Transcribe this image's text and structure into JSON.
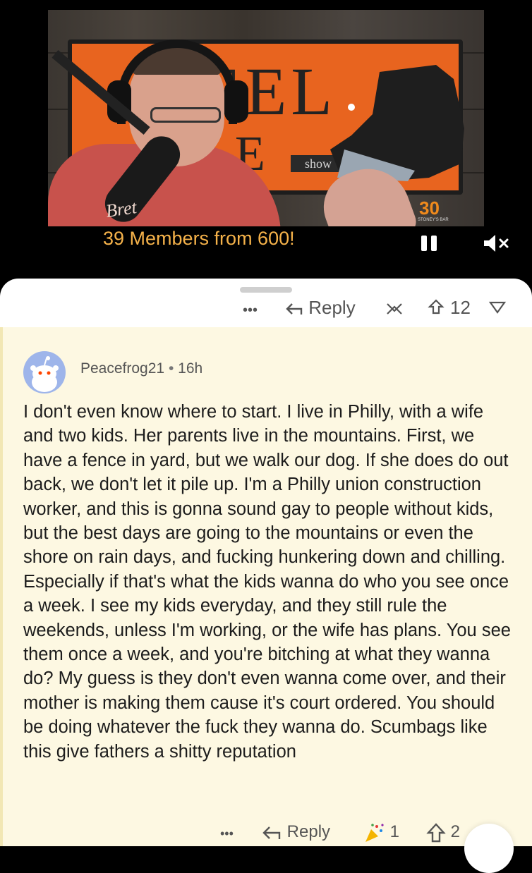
{
  "video": {
    "caption": "39 Members from 600!",
    "sign_letters_top": "EEL",
    "sign_letters_bottom": "E",
    "sign_show": "show",
    "shirt_text": "Bret",
    "logo_number": "30",
    "logo_sub": "STONEY'S BAR"
  },
  "prev_comment_actions": {
    "more": "•••",
    "reply_label": "Reply",
    "vote_count": "12"
  },
  "comment": {
    "username": "Peacefrog21",
    "separator": "•",
    "age": "16h",
    "body": "I don't even know where to start. I live in Philly, with a wife and two kids. Her parents live in the mountains. First, we have a fence in yard, but we walk our dog. If she does do out back, we don't let it pile up. I'm a Philly union construction worker, and this is gonna sound gay to people without kids, but the best days are going to the mountains or even the shore on rain days, and fucking hunkering down and chilling. Especially if that's what the kids wanna do who you see once a week. I see my kids everyday, and they still rule the weekends, unless I'm working, or the wife has plans. You see them once a week, and you're bitching at what they wanna do? My guess is they don't even wanna come over, and their mother is making them cause it's court ordered. You should be doing whatever the fuck they wanna do. Scumbags like this give fathers a shitty reputation",
    "actions": {
      "more": "•••",
      "reply_label": "Reply",
      "award_count": "1",
      "vote_count": "2"
    }
  },
  "colors": {
    "highlight_bg": "#fdf8e2",
    "caption": "#f5b24a",
    "avatar_bg": "#9eb5ea",
    "sign_orange": "#e8641f"
  },
  "icons": [
    "pause-icon",
    "mute-icon",
    "reply-arrow-icon",
    "award-icon",
    "upvote-icon",
    "downvote-icon",
    "snoo-avatar-icon"
  ]
}
